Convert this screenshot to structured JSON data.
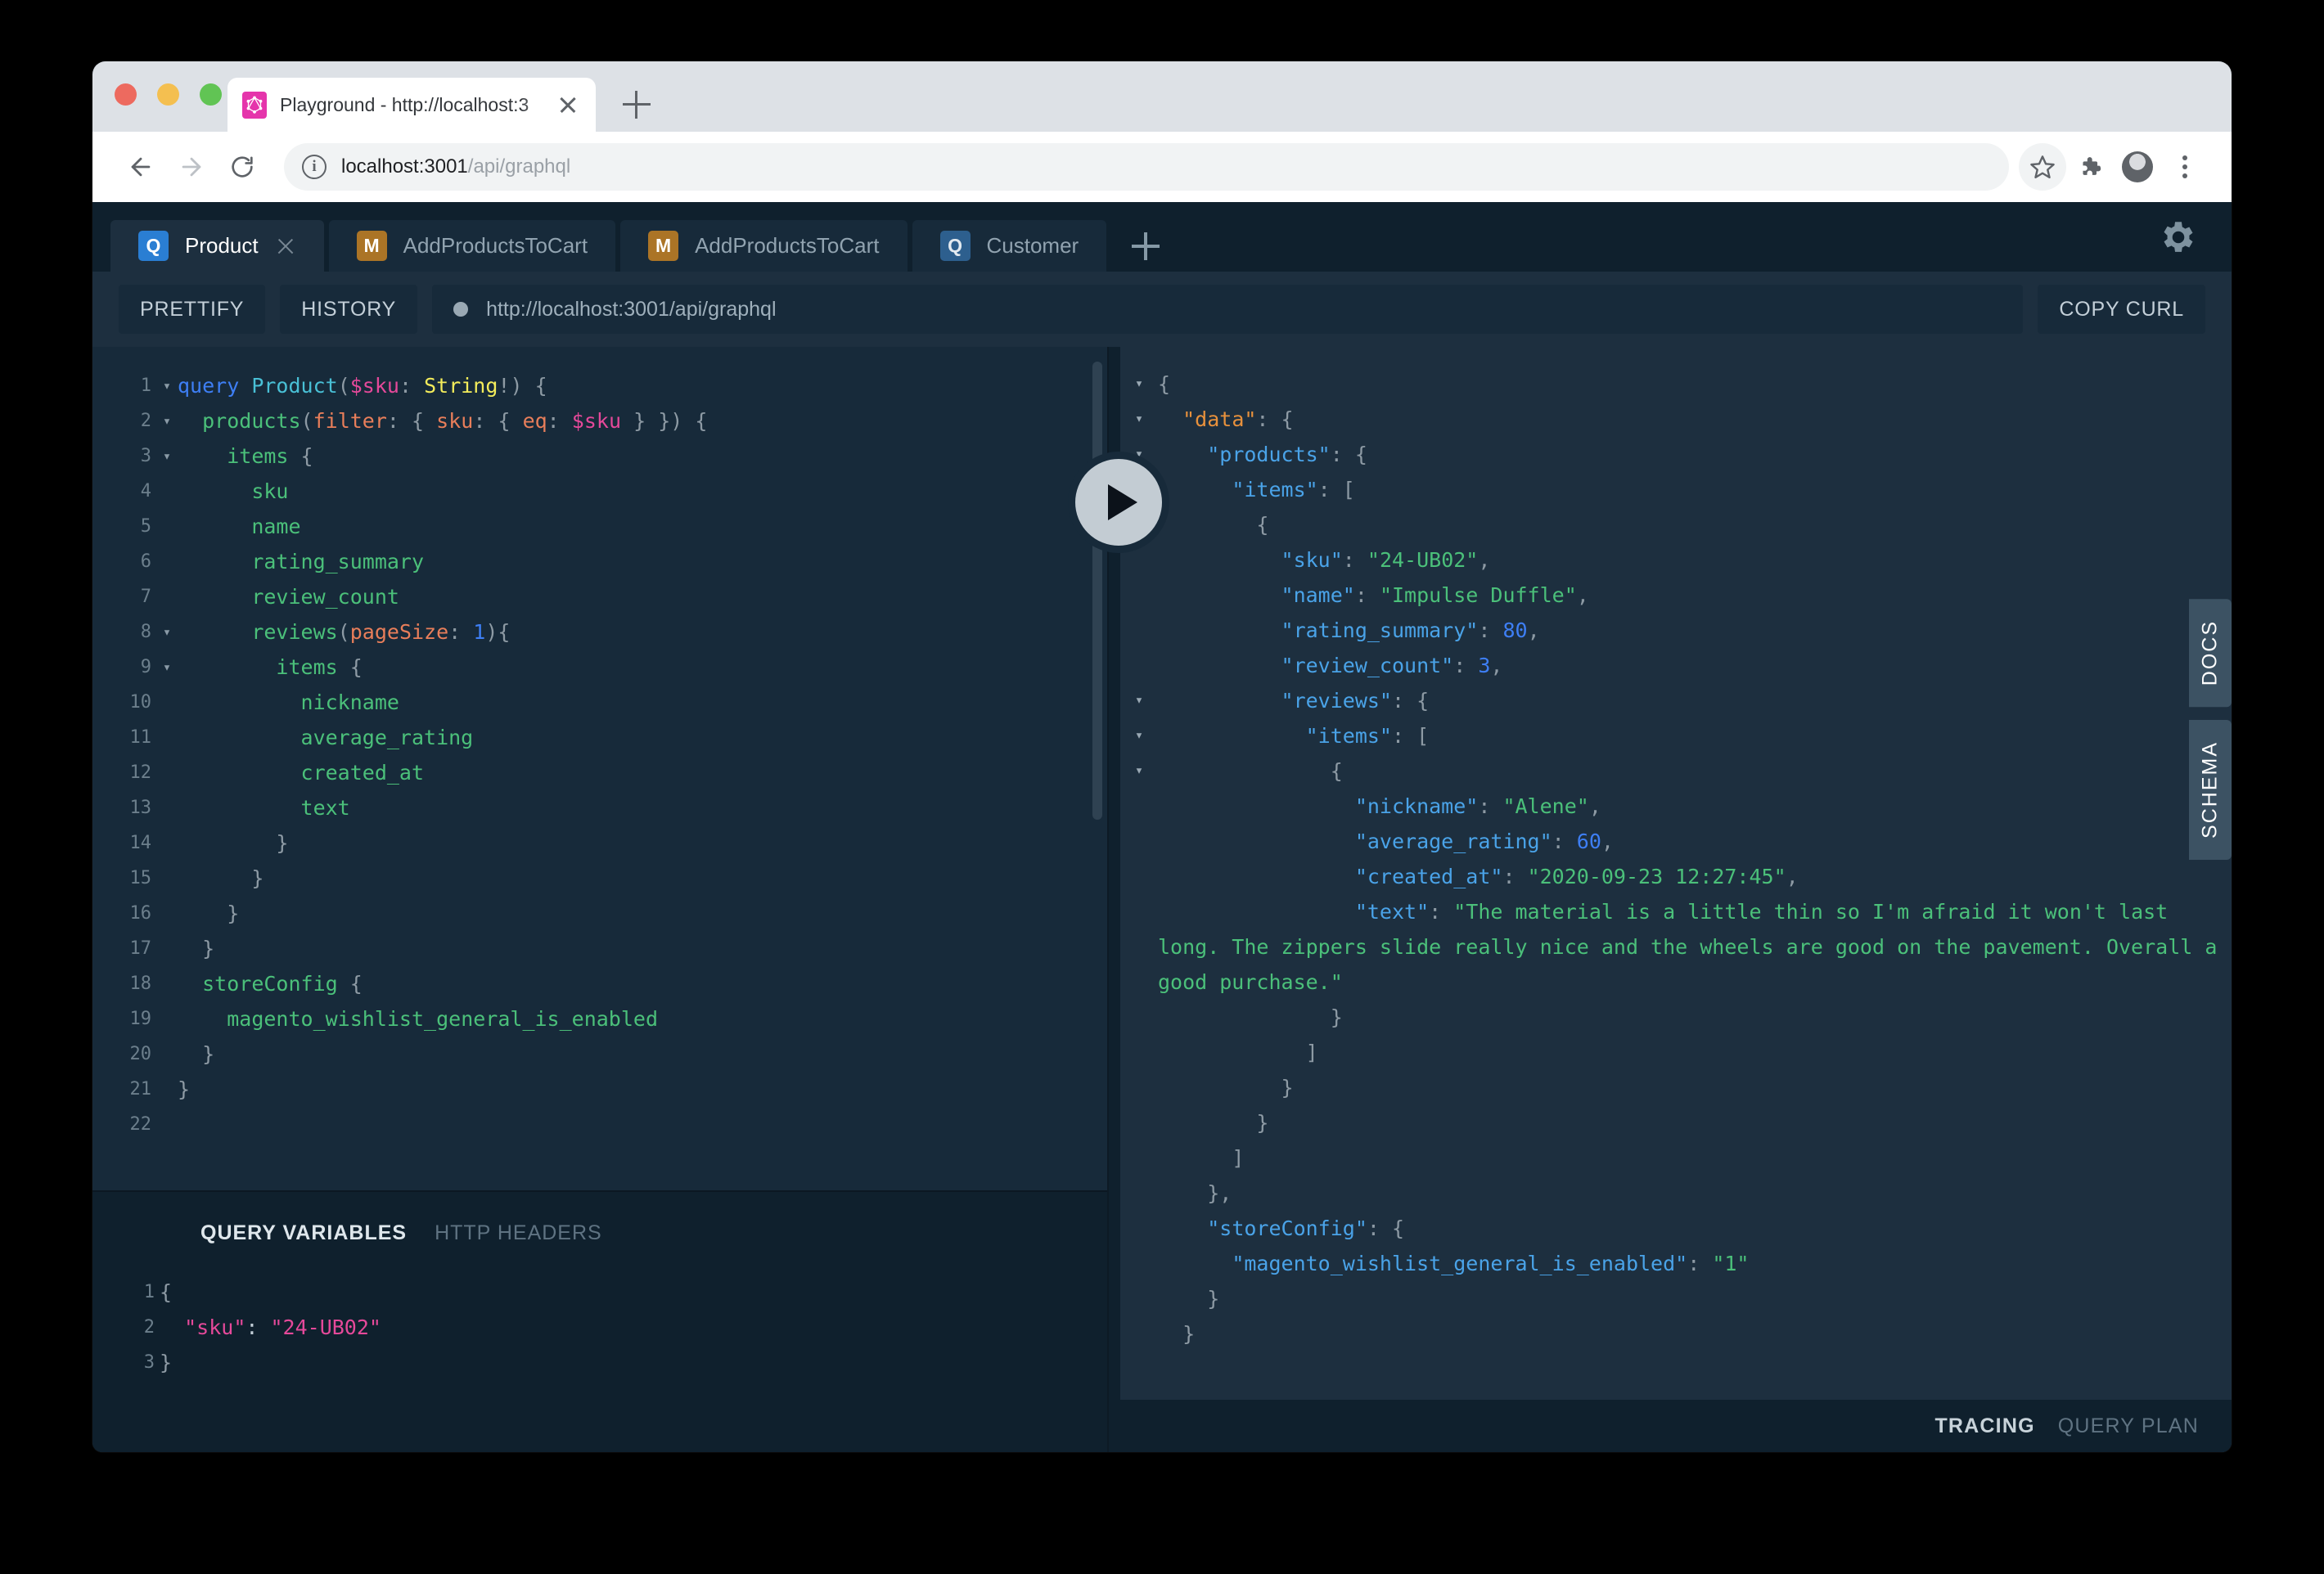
{
  "browser": {
    "tab_title": "Playground - http://localhost:3",
    "url_prefix": "localhost:3001",
    "url_suffix": "/api/graphql",
    "favicon_name": "graphql-logo-icon"
  },
  "playground": {
    "tabs": [
      {
        "badge": "Q",
        "badge_type": "q",
        "label": "Product",
        "active": true,
        "closable": true
      },
      {
        "badge": "M",
        "badge_type": "m",
        "label": "AddProductsToCart",
        "active": false,
        "closable": false
      },
      {
        "badge": "M",
        "badge_type": "m",
        "label": "AddProductsToCart",
        "active": false,
        "closable": false
      },
      {
        "badge": "Q",
        "badge_type": "q-dim",
        "label": "Customer",
        "active": false,
        "closable": false
      }
    ],
    "toolbar": {
      "prettify": "PRETTIFY",
      "history": "HISTORY",
      "endpoint": "http://localhost:3001/api/graphql",
      "copy_curl": "COPY CURL"
    },
    "side_tabs": [
      "DOCS",
      "SCHEMA"
    ],
    "footer_tabs": [
      {
        "label": "TRACING",
        "active": true
      },
      {
        "label": "QUERY PLAN",
        "active": false
      }
    ]
  },
  "query_editor": {
    "lines": [
      {
        "n": "1",
        "fold": "▾"
      },
      {
        "n": "2",
        "fold": "▾"
      },
      {
        "n": "3",
        "fold": "▾"
      },
      {
        "n": "4",
        "fold": ""
      },
      {
        "n": "5",
        "fold": ""
      },
      {
        "n": "6",
        "fold": ""
      },
      {
        "n": "7",
        "fold": ""
      },
      {
        "n": "8",
        "fold": "▾"
      },
      {
        "n": "9",
        "fold": "▾"
      },
      {
        "n": "10",
        "fold": ""
      },
      {
        "n": "11",
        "fold": ""
      },
      {
        "n": "12",
        "fold": ""
      },
      {
        "n": "13",
        "fold": ""
      },
      {
        "n": "14",
        "fold": ""
      },
      {
        "n": "15",
        "fold": ""
      },
      {
        "n": "16",
        "fold": ""
      },
      {
        "n": "17",
        "fold": ""
      },
      {
        "n": "18",
        "fold": ""
      },
      {
        "n": "19",
        "fold": ""
      },
      {
        "n": "20",
        "fold": ""
      },
      {
        "n": "21",
        "fold": ""
      },
      {
        "n": "22",
        "fold": ""
      }
    ],
    "code": [
      "query Product($sku: String!) {",
      "  products(filter: { sku: { eq: $sku } }) {",
      "    items {",
      "      sku",
      "      name",
      "      rating_summary",
      "      review_count",
      "      reviews(pageSize: 1) {",
      "        items {",
      "          nickname",
      "          average_rating",
      "          created_at",
      "          text",
      "        }",
      "      }",
      "    }",
      "  }",
      "  storeConfig {",
      "    magento_wishlist_general_is_enabled",
      "  }",
      "}",
      ""
    ]
  },
  "variables_editor": {
    "tabs": [
      {
        "label": "QUERY VARIABLES",
        "active": true
      },
      {
        "label": "HTTP HEADERS",
        "active": false
      }
    ],
    "lines": [
      "1",
      "2",
      "3"
    ],
    "code": [
      "{",
      "  \"sku\": \"24-UB02\"",
      "}"
    ]
  },
  "response": {
    "sku": "24-UB02",
    "name": "Impulse Duffle",
    "rating_summary": "80",
    "review_count": "3",
    "review_nickname": "Alene",
    "review_average_rating": "60",
    "review_created_at": "2020-09-23 12:27:45",
    "review_text": "The material is a little thin so I'm afraid it won't last long. The zippers slide really nice and the wheels are good on the pavement. Overall a good purchase.",
    "magento_wishlist_general_is_enabled": "1",
    "keys": {
      "data": "data",
      "products": "products",
      "items": "items",
      "sku": "sku",
      "name": "name",
      "rating_summary": "rating_summary",
      "review_count": "review_count",
      "reviews": "reviews",
      "nickname": "nickname",
      "average_rating": "average_rating",
      "created_at": "created_at",
      "text": "text",
      "storeConfig": "storeConfig",
      "wishlist": "magento_wishlist_general_is_enabled"
    }
  },
  "colors": {
    "pg_bg": "#172a3a",
    "pg_panel": "#1d2f3f",
    "pg_dark": "#0f202d",
    "accent_blue": "#2a7ed3",
    "accent_orange": "#ab7426",
    "json_key": "#4aa3e8",
    "json_string": "#4bc07a",
    "json_data_key": "#e8913c",
    "graphql_pink": "#e535ab"
  }
}
